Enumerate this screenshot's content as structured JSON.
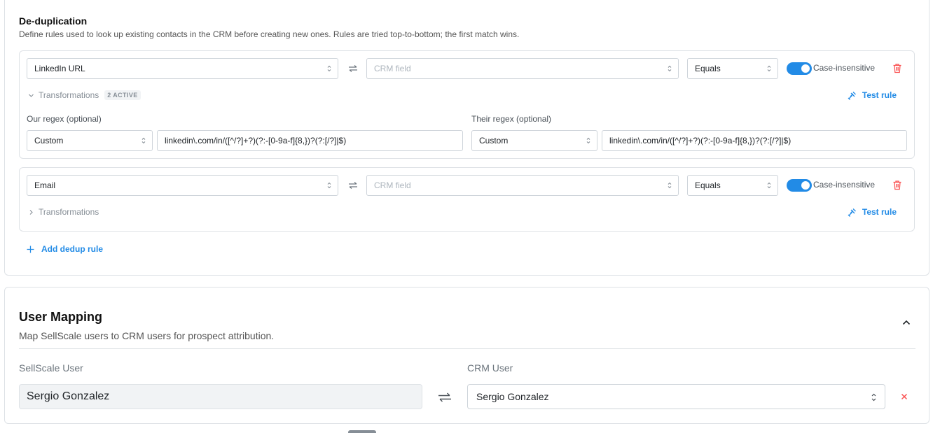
{
  "dedup": {
    "title": "De-duplication",
    "description": "Define rules used to look up existing contacts in the CRM before creating new ones. Rules are tried top-to-bottom; the first match wins.",
    "rules": [
      {
        "source_field": "LinkedIn URL",
        "crm_field_placeholder": "CRM field",
        "operator": "Equals",
        "case_insensitive_label": "Case-insensitive",
        "case_insensitive": true,
        "transformations_label": "Transformations",
        "transformations_badge": "2 ACTIVE",
        "expanded": true,
        "test_rule_label": "Test rule",
        "our_regex_label": "Our regex (optional)",
        "our_regex_mode": "Custom",
        "our_regex_value": "linkedin\\.com/in/([^/?]+?)(?:-[0-9a-f]{8,})?(?:[/?]|$)",
        "their_regex_label": "Their regex (optional)",
        "their_regex_mode": "Custom",
        "their_regex_value": "linkedin\\.com/in/([^/?]+?)(?:-[0-9a-f]{8,})?(?:[/?]|$)"
      },
      {
        "source_field": "Email",
        "crm_field_placeholder": "CRM field",
        "operator": "Equals",
        "case_insensitive_label": "Case-insensitive",
        "case_insensitive": true,
        "transformations_label": "Transformations",
        "expanded": false,
        "test_rule_label": "Test rule"
      }
    ],
    "add_rule_label": "Add dedup rule"
  },
  "user_mapping": {
    "title": "User Mapping",
    "description": "Map SellScale users to CRM users for prospect attribution.",
    "sellscale_user_label": "SellScale User",
    "crm_user_label": "CRM User",
    "rows": [
      {
        "sellscale_user": "Sergio Gonzalez",
        "crm_user": "Sergio Gonzalez"
      }
    ]
  },
  "colors": {
    "accent": "#228be6",
    "danger": "#fa5252",
    "border": "#dee2e6"
  }
}
